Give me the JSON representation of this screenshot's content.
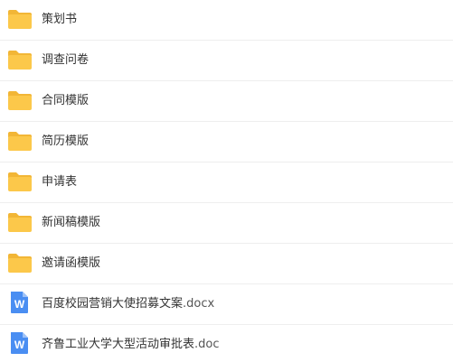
{
  "colors": {
    "folder": "#fcc84a",
    "folder_tab": "#f2b636",
    "word_doc": "#4a8ef2",
    "word_doc_fold": "#9dc2f8",
    "text": "#333333",
    "divider": "#eeeeee"
  },
  "items": [
    {
      "type": "folder",
      "icon": "folder-icon",
      "name": "策划书"
    },
    {
      "type": "folder",
      "icon": "folder-icon",
      "name": "调查问卷"
    },
    {
      "type": "folder",
      "icon": "folder-icon",
      "name": "合同模版"
    },
    {
      "type": "folder",
      "icon": "folder-icon",
      "name": "简历模版"
    },
    {
      "type": "folder",
      "icon": "folder-icon",
      "name": "申请表"
    },
    {
      "type": "folder",
      "icon": "folder-icon",
      "name": "新闻稿模版"
    },
    {
      "type": "folder",
      "icon": "folder-icon",
      "name": "邀请函模版"
    },
    {
      "type": "file",
      "icon": "word-doc-icon",
      "icon_letter": "W",
      "name": "百度校园营销大使招募文案",
      "ext": ".docx"
    },
    {
      "type": "file",
      "icon": "word-doc-icon",
      "icon_letter": "W",
      "name": "齐鲁工业大学大型活动审批表",
      "ext": ".doc"
    }
  ]
}
